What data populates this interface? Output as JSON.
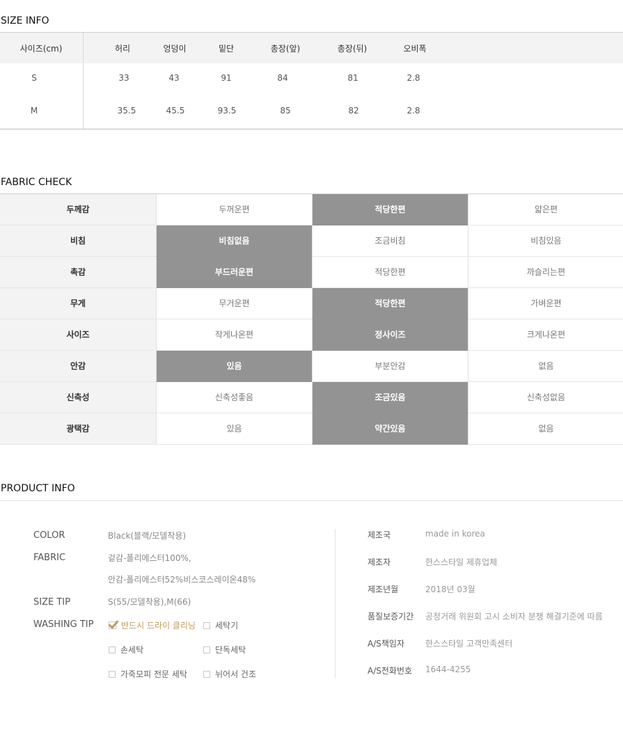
{
  "size_info": {
    "title": "SIZE INFO",
    "headers": [
      "사이즈(cm)",
      "허리",
      "엉덩이",
      "밑단",
      "총장(앞)",
      "총장(뒤)",
      "오비폭"
    ],
    "rows": [
      [
        "S",
        "33",
        "43",
        "91",
        "84",
        "81",
        "2.8"
      ],
      [
        "M",
        "35.5",
        "45.5",
        "93.5",
        "85",
        "82",
        "2.8"
      ]
    ]
  },
  "fabric_check": {
    "title": "FABRIC CHECK",
    "rows": [
      {
        "label": "두께감",
        "options": [
          "두꺼운편",
          "적당한편",
          "얇은편"
        ],
        "selected": 1
      },
      {
        "label": "비침",
        "options": [
          "비침없음",
          "조금비침",
          "비침있음"
        ],
        "selected": 0
      },
      {
        "label": "촉감",
        "options": [
          "부드러운편",
          "적당한편",
          "까슬리는편"
        ],
        "selected": 0
      },
      {
        "label": "무게",
        "options": [
          "무거운편",
          "적당한편",
          "가벼운편"
        ],
        "selected": 1
      },
      {
        "label": "사이즈",
        "options": [
          "작게나온편",
          "정사이즈",
          "크게나온편"
        ],
        "selected": 1
      },
      {
        "label": "안감",
        "options": [
          "있음",
          "부분안감",
          "없음"
        ],
        "selected": 0
      },
      {
        "label": "신축성",
        "options": [
          "신축성좋음",
          "조금있음",
          "신축성없음"
        ],
        "selected": 1
      },
      {
        "label": "광택감",
        "options": [
          "있음",
          "약간있음",
          "없음"
        ],
        "selected": 1
      }
    ],
    "selected_color": "#939393"
  },
  "product_info": {
    "title": "PRODUCT INFO",
    "color_label": "COLOR",
    "color_value": "Black(블랙/모델착용)",
    "fabric_label": "FABRIC",
    "fabric_value_1": "겉감-폴리에스터100%,",
    "fabric_value_2": "안감-폴리에스터52%비스코스레이온48%",
    "size_tip_label": "SIZE TIP",
    "size_tip_value": "S(55/모델착용),M(66)",
    "washing_label": "WASHING TIP",
    "washing_options": [
      {
        "label": "반드시 드라이 클리닝",
        "checked": true
      },
      {
        "label": "세탁기",
        "checked": false
      },
      {
        "label": "손세탁",
        "checked": false
      },
      {
        "label": "단독세탁",
        "checked": false
      },
      {
        "label": "가죽모피 전문 세탁",
        "checked": false
      },
      {
        "label": "뉘어서 건조",
        "checked": false
      }
    ],
    "maker": [
      {
        "label": "제조국",
        "value": "made in korea"
      },
      {
        "label": "제조자",
        "value": "한스스타일 제휴업체"
      },
      {
        "label": "제조년월",
        "value": "2018년 03월"
      },
      {
        "label": "품질보증기간",
        "value": "공정거래 위원회 고시 소비자 분쟁 해결기준에 따름"
      },
      {
        "label": "A/S책임자",
        "value": "한스스타일 고객만족센터"
      },
      {
        "label": "A/S전화번호",
        "value": "1644-4255"
      }
    ],
    "accent_color": "#c09a5b"
  }
}
